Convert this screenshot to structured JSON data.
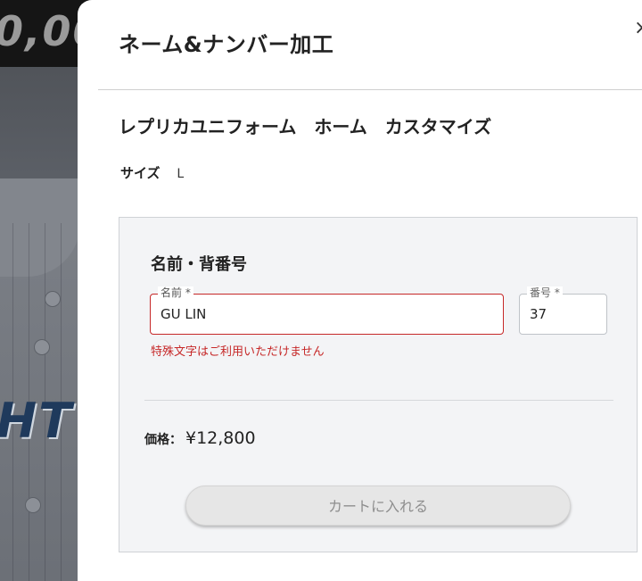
{
  "background": {
    "price_fragment": "0,00",
    "jersey_lettering": "HT"
  },
  "modal": {
    "title": "ネーム&ナンバー加工",
    "close_label": "×",
    "product_name": "レプリカユニフォーム　ホーム　カスタマイズ",
    "size": {
      "label": "サイズ",
      "value": "L"
    }
  },
  "form": {
    "section_title": "名前・背番号",
    "name_field": {
      "label": "名前 *",
      "value": "GU LIN"
    },
    "number_field": {
      "label": "番号 *",
      "value": "37"
    },
    "error": "特殊文字はご利用いただけません",
    "price": {
      "label": "価格：",
      "value": "¥12,800"
    },
    "cart_button": "カートに入れる"
  },
  "colors": {
    "error": "#c62828",
    "panel_bg": "#f3f4f6",
    "button_disabled_bg": "#e6e6e6"
  }
}
